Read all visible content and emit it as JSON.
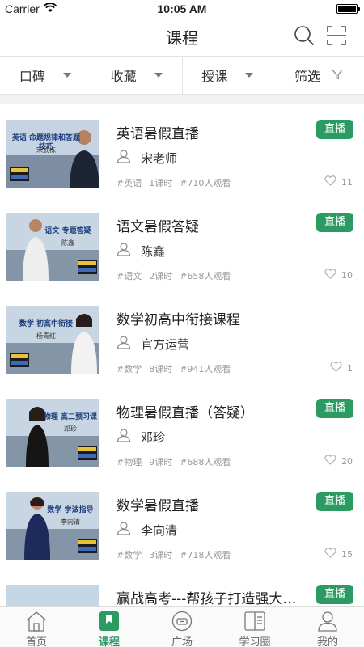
{
  "status_bar": {
    "carrier": "Carrier",
    "time": "10:05 AM"
  },
  "header": {
    "title": "课程",
    "search_icon": "search-icon",
    "scan_icon": "scan-icon"
  },
  "filters": [
    {
      "label": "口碑",
      "icon": "caret-down-icon"
    },
    {
      "label": "收藏",
      "icon": "caret-down-icon"
    },
    {
      "label": "授课",
      "icon": "caret-down-icon"
    },
    {
      "label": "筛选",
      "icon": "funnel-icon"
    }
  ],
  "courses": [
    {
      "title": "英语暑假直播",
      "badge": "直播",
      "teacher": "宋老师",
      "tag": "#英语",
      "lessons": "1课时",
      "views": "#710人观看",
      "likes": "11",
      "thumb_text": "英语 命题规律和答题技巧",
      "thumb_name": "宋武栋"
    },
    {
      "title": "语文暑假答疑",
      "badge": "直播",
      "teacher": "陈鑫",
      "tag": "#语文",
      "lessons": "2课时",
      "views": "#658人观看",
      "likes": "10",
      "thumb_text": "语文 专题答疑",
      "thumb_name": "陈鑫"
    },
    {
      "title": "数学初高中衔接课程",
      "badge": "",
      "teacher": "官方运营",
      "tag": "#数学",
      "lessons": "8课时",
      "views": "#941人观看",
      "likes": "1",
      "thumb_text": "数学 初高中衔接",
      "thumb_name": "杨青红"
    },
    {
      "title": "物理暑假直播（答疑）",
      "badge": "直播",
      "teacher": "邓珍",
      "tag": "#物理",
      "lessons": "9课时",
      "views": "#688人观看",
      "likes": "20",
      "thumb_text": "物理 高二预习课",
      "thumb_name": "邓珍"
    },
    {
      "title": "数学暑假直播",
      "badge": "直播",
      "teacher": "李向清",
      "tag": "#数学",
      "lessons": "3课时",
      "views": "#718人观看",
      "likes": "15",
      "thumb_text": "数学 学法指导",
      "thumb_name": "李向清"
    },
    {
      "title": "赢战高考---帮孩子打造强大…",
      "badge": "直播",
      "teacher": "",
      "tag": "",
      "lessons": "",
      "views": "",
      "likes": "",
      "thumb_text": "",
      "thumb_name": ""
    }
  ],
  "tabs": [
    {
      "label": "首页",
      "icon": "home-icon",
      "active": false
    },
    {
      "label": "课程",
      "icon": "course-icon",
      "active": true
    },
    {
      "label": "广场",
      "icon": "square-icon",
      "active": false
    },
    {
      "label": "学习圈",
      "icon": "study-circle-icon",
      "active": false
    },
    {
      "label": "我的",
      "icon": "profile-icon",
      "active": false
    }
  ],
  "colors": {
    "accent": "#2b9b61",
    "meta_text": "#9a9a9a",
    "divider": "#e2e2e2"
  }
}
